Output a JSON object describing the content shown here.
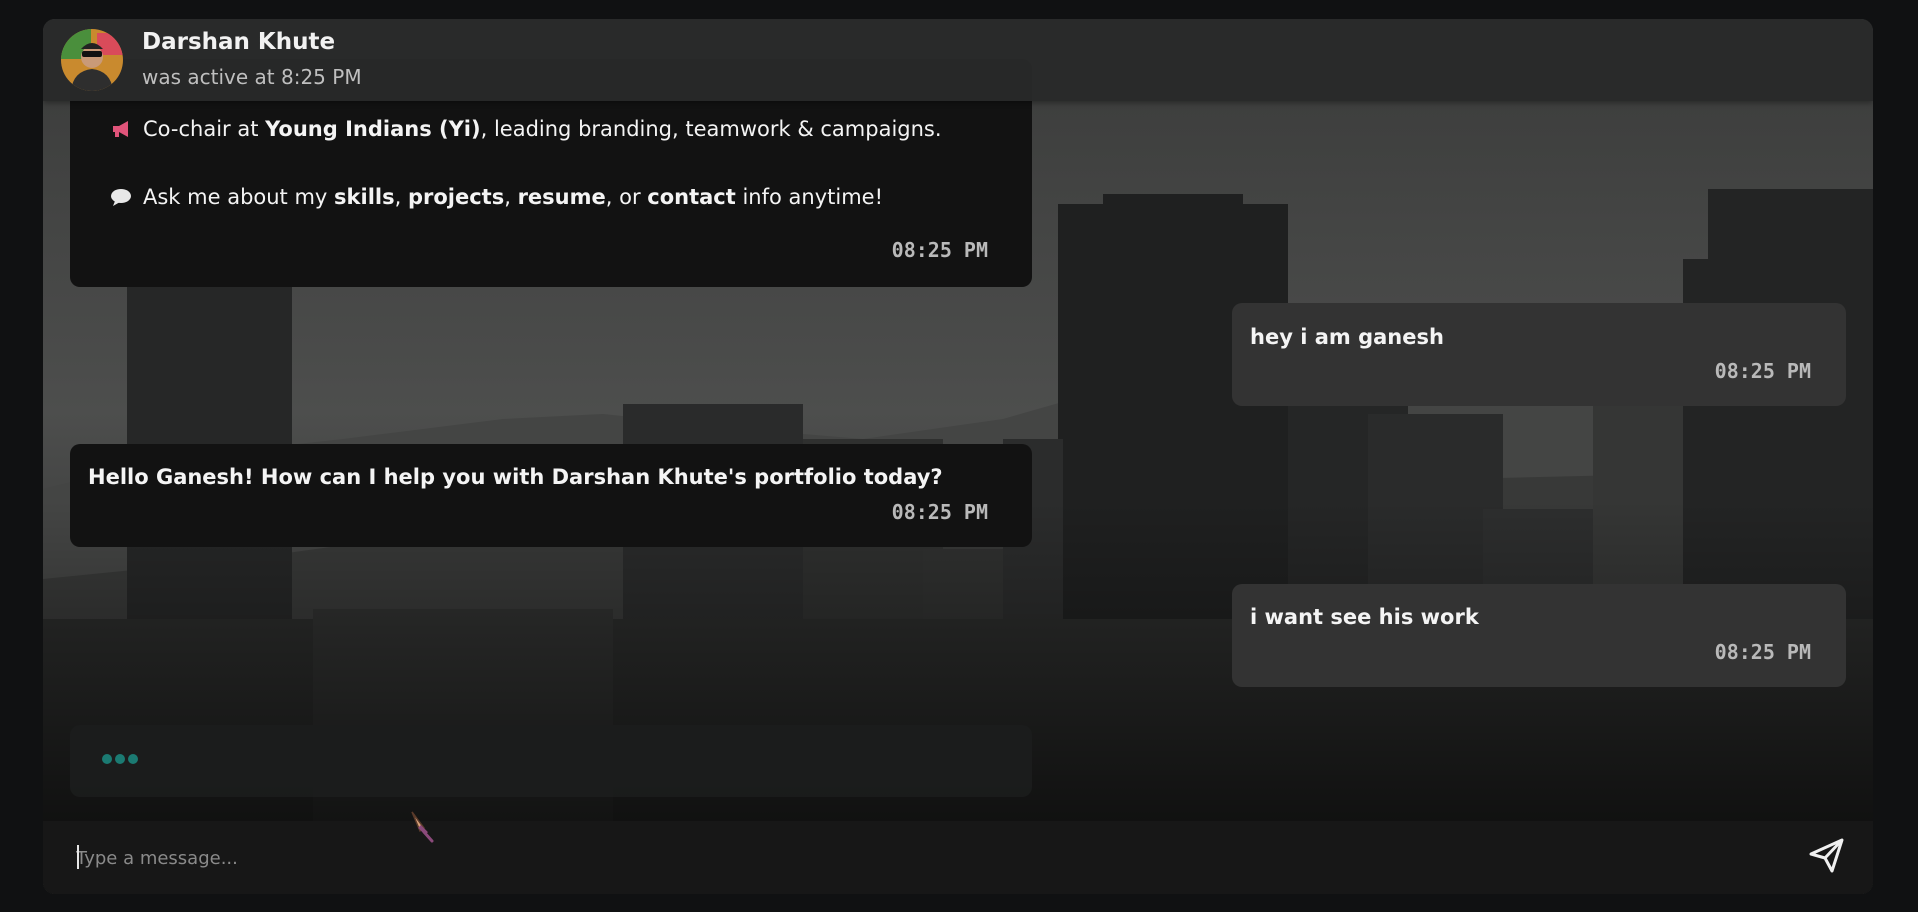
{
  "header": {
    "name": "Darshan Khute",
    "status": "was active at 8:25 PM"
  },
  "messages": [
    {
      "sender": "bot",
      "lines": [
        {
          "icon": "megaphone-icon",
          "parts": [
            "Co-chair at ",
            "Young Indians (Yi)",
            ", leading branding, teamwork & campaigns."
          ]
        },
        {
          "icon": "speech-bubble-icon",
          "parts": [
            "Ask me about my ",
            "skills",
            ", ",
            "projects",
            ", ",
            "resume",
            ", or ",
            "contact",
            " info anytime!"
          ]
        }
      ],
      "time": "08:25 PM"
    },
    {
      "sender": "user",
      "text": "hey i am ganesh",
      "time": "08:25 PM"
    },
    {
      "sender": "bot",
      "text": "Hello Ganesh! How can I help you with Darshan Khute's portfolio today?",
      "time": "08:25 PM"
    },
    {
      "sender": "user",
      "text": "i want see his work",
      "time": "08:25 PM"
    }
  ],
  "typing_indicator": "dots-icon",
  "composer": {
    "placeholder": "Type a message...",
    "value": "",
    "send_icon": "send-icon"
  },
  "colors": {
    "accent": "#1b7a72",
    "bot_bubble": "#121212",
    "user_bubble": "#333333",
    "page_bg": "#101112"
  }
}
